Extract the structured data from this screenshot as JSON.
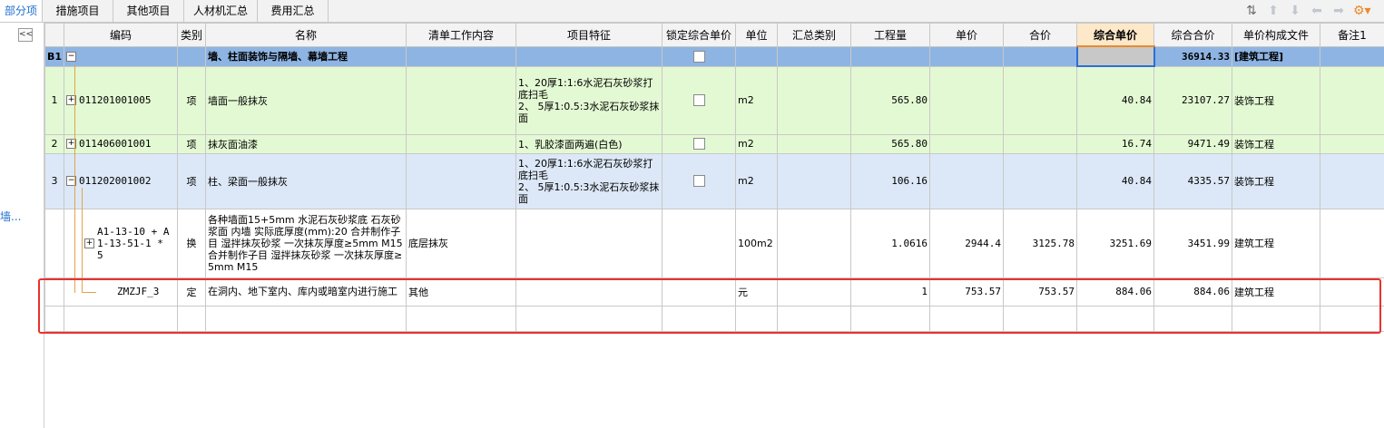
{
  "tabs": [
    {
      "label": "部分项",
      "active": true
    },
    {
      "label": "措施项目",
      "active": false
    },
    {
      "label": "其他项目",
      "active": false
    },
    {
      "label": "人材机汇总",
      "active": false
    },
    {
      "label": "费用汇总",
      "active": false
    }
  ],
  "left_panel": {
    "collapse_label": "<<",
    "item_label": "墙..."
  },
  "columns": [
    "",
    "编码",
    "类别",
    "名称",
    "清单工作内容",
    "项目特征",
    "锁定综合单价",
    "单位",
    "汇总类别",
    "工程量",
    "单价",
    "合价",
    "综合单价",
    "综合合价",
    "单价构成文件",
    "备注1"
  ],
  "rows": [
    {
      "no": "B1",
      "code": "",
      "type": "",
      "name": "墙、柱面装饰与隔墙、幕墙工程",
      "content": "",
      "feature": "",
      "unit": "",
      "summary": "",
      "qty": "",
      "price": "",
      "total": "",
      "comp_price": "",
      "comp_total": "36914.33",
      "file": "[建筑工程]",
      "note": ""
    },
    {
      "no": "1",
      "code": "011201001005",
      "type": "项",
      "name": "墙面一般抹灰",
      "content": "",
      "feature": "1、20厚1:1:6水泥石灰砂浆打底扫毛\n2、 5厚1:0.5:3水泥石灰砂浆抹面",
      "unit": "m2",
      "summary": "",
      "qty": "565.80",
      "price": "",
      "total": "",
      "comp_price": "40.84",
      "comp_total": "23107.27",
      "file": "装饰工程",
      "note": ""
    },
    {
      "no": "2",
      "code": "011406001001",
      "type": "项",
      "name": "抹灰面油漆",
      "content": "",
      "feature": "1、乳胶漆面两遍(白色)",
      "unit": "m2",
      "summary": "",
      "qty": "565.80",
      "price": "",
      "total": "",
      "comp_price": "16.74",
      "comp_total": "9471.49",
      "file": "装饰工程",
      "note": ""
    },
    {
      "no": "3",
      "code": "011202001002",
      "type": "项",
      "name": "柱、梁面一般抹灰",
      "content": "",
      "feature": "1、20厚1:1:6水泥石灰砂浆打底扫毛\n2、 5厚1:0.5:3水泥石灰砂浆抹面",
      "unit": "m2",
      "summary": "",
      "qty": "106.16",
      "price": "",
      "total": "",
      "comp_price": "40.84",
      "comp_total": "4335.57",
      "file": "装饰工程",
      "note": ""
    },
    {
      "no": "",
      "code": "A1-13-10 + A1-13-51-1 * 5",
      "type": "换",
      "name": "各种墙面15+5mm 水泥石灰砂浆底 石灰砂浆面 内墙  实际底厚度(mm):20  合并制作子目 湿拌抹灰砂浆 一次抹灰厚度≥5mm M15  合并制作子目 湿拌抹灰砂浆 一次抹灰厚度≥5mm M15",
      "content": "底层抹灰",
      "feature": "",
      "unit": "100m2",
      "summary": "",
      "qty": "1.0616",
      "price": "2944.4",
      "total": "3125.78",
      "comp_price": "3251.69",
      "comp_total": "3451.99",
      "file": "建筑工程",
      "note": ""
    },
    {
      "no": "",
      "code": "ZMZJF_3",
      "type": "定",
      "name": "在洞内、地下室内、库内或暗室内进行施工",
      "content": "其他",
      "feature": "",
      "unit": "元",
      "summary": "",
      "qty": "1",
      "price": "753.57",
      "total": "753.57",
      "comp_price": "884.06",
      "comp_total": "884.06",
      "file": "建筑工程",
      "note": ""
    }
  ],
  "colors": {
    "accent_tab": "#1f6fd1",
    "row_b1": "#8eb4e3",
    "row_green": "#e3f9d3",
    "row_blue": "#dce8f7",
    "highlight": "#e8322e"
  },
  "toolbar_icons": [
    "sort-icon",
    "arrow-up-icon",
    "arrow-down-icon",
    "arrow-left-icon",
    "arrow-right-icon",
    "settings-icon"
  ]
}
